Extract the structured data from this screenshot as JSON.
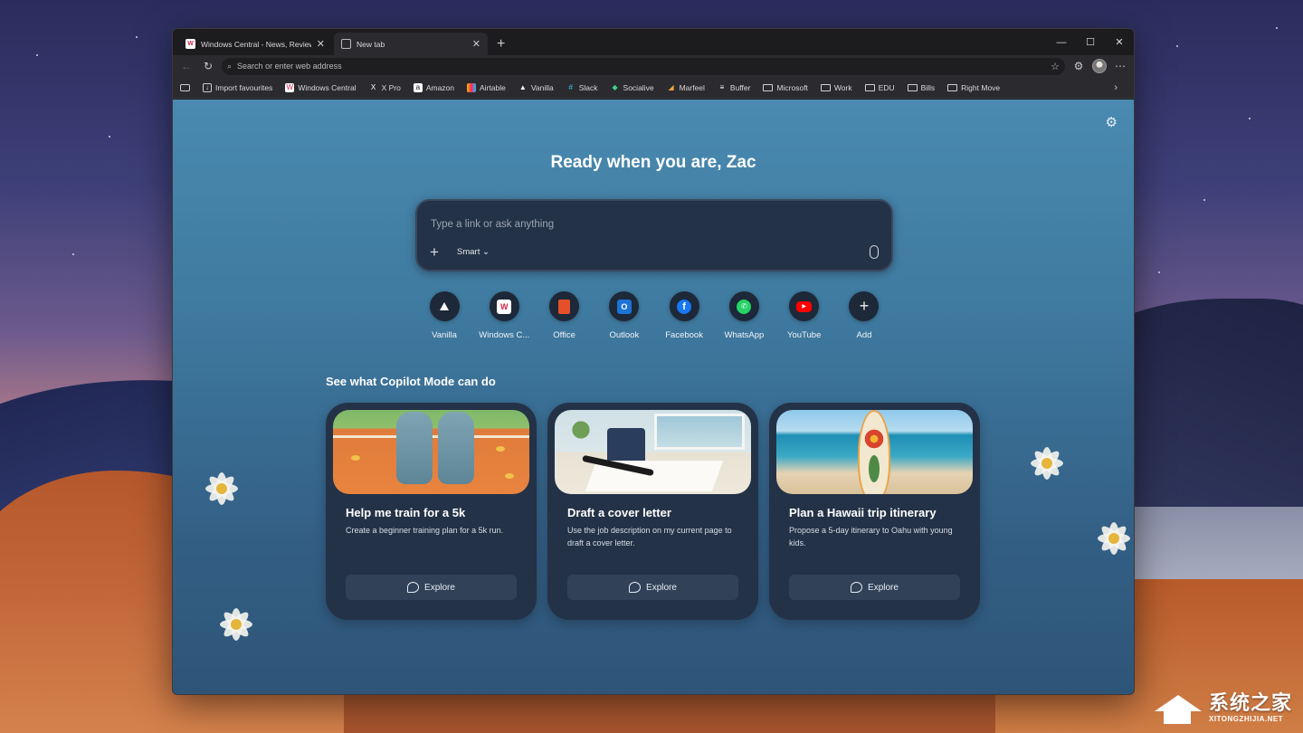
{
  "browser": {
    "tabs": [
      {
        "title": "Windows Central - News, Reviews",
        "favicon": "windows-central-favicon",
        "active": false
      },
      {
        "title": "New tab",
        "favicon": "new-tab-favicon",
        "active": true
      }
    ],
    "new_tab_symbol": "+",
    "window_controls": {
      "minimize": "—",
      "maximize": "☐",
      "close": "✕"
    },
    "address_bar": {
      "placeholder": "Search or enter web address"
    },
    "bookmarks": [
      {
        "label": "Import favourites",
        "icon": "import-icon"
      },
      {
        "label": "Windows Central",
        "icon": "windows-central-icon"
      },
      {
        "label": "X Pro",
        "icon": "x-icon"
      },
      {
        "label": "Amazon",
        "icon": "amazon-icon"
      },
      {
        "label": "Airtable",
        "icon": "airtable-icon"
      },
      {
        "label": "Vanilla",
        "icon": "vanilla-icon"
      },
      {
        "label": "Slack",
        "icon": "slack-icon"
      },
      {
        "label": "Socialive",
        "icon": "socialive-icon"
      },
      {
        "label": "Marfeel",
        "icon": "marfeel-icon"
      },
      {
        "label": "Buffer",
        "icon": "buffer-icon"
      },
      {
        "label": "Microsoft",
        "icon": "folder-icon"
      },
      {
        "label": "Work",
        "icon": "folder-icon"
      },
      {
        "label": "EDU",
        "icon": "folder-icon"
      },
      {
        "label": "Bills",
        "icon": "folder-icon"
      },
      {
        "label": "Right Move",
        "icon": "folder-icon"
      }
    ]
  },
  "ntp": {
    "greeting": "Ready when you are, Zac",
    "prompt": {
      "placeholder": "Type a link or ask anything",
      "mode": "Smart"
    },
    "shortcuts": [
      {
        "label": "Vanilla",
        "icon": "vanilla-icon"
      },
      {
        "label": "Windows C...",
        "icon": "windows-central-icon"
      },
      {
        "label": "Office",
        "icon": "office-icon"
      },
      {
        "label": "Outlook",
        "icon": "outlook-icon"
      },
      {
        "label": "Facebook",
        "icon": "facebook-icon"
      },
      {
        "label": "WhatsApp",
        "icon": "whatsapp-icon"
      },
      {
        "label": "YouTube",
        "icon": "youtube-icon"
      },
      {
        "label": "Add",
        "icon": "plus-icon"
      }
    ],
    "copilot_heading": "See what Copilot Mode can do",
    "cards": [
      {
        "title": "Help me train for a 5k",
        "description": "Create a beginner training plan for a 5k run.",
        "button": "Explore"
      },
      {
        "title": "Draft a cover letter",
        "description": "Use the job description on my current page to draft a cover letter.",
        "button": "Explore"
      },
      {
        "title": "Plan a Hawaii trip itinerary",
        "description": "Propose a 5-day itinerary to Oahu with young kids.",
        "button": "Explore"
      }
    ]
  },
  "watermark": {
    "cn": "系统之家",
    "en": "XITONGZHIJIA.NET"
  },
  "colors": {
    "window_bg": "#1c1c1f",
    "toolbar_bg": "#2b2b2f",
    "card_bg": "#243247",
    "ntp_bg": "#3f7aa0"
  }
}
